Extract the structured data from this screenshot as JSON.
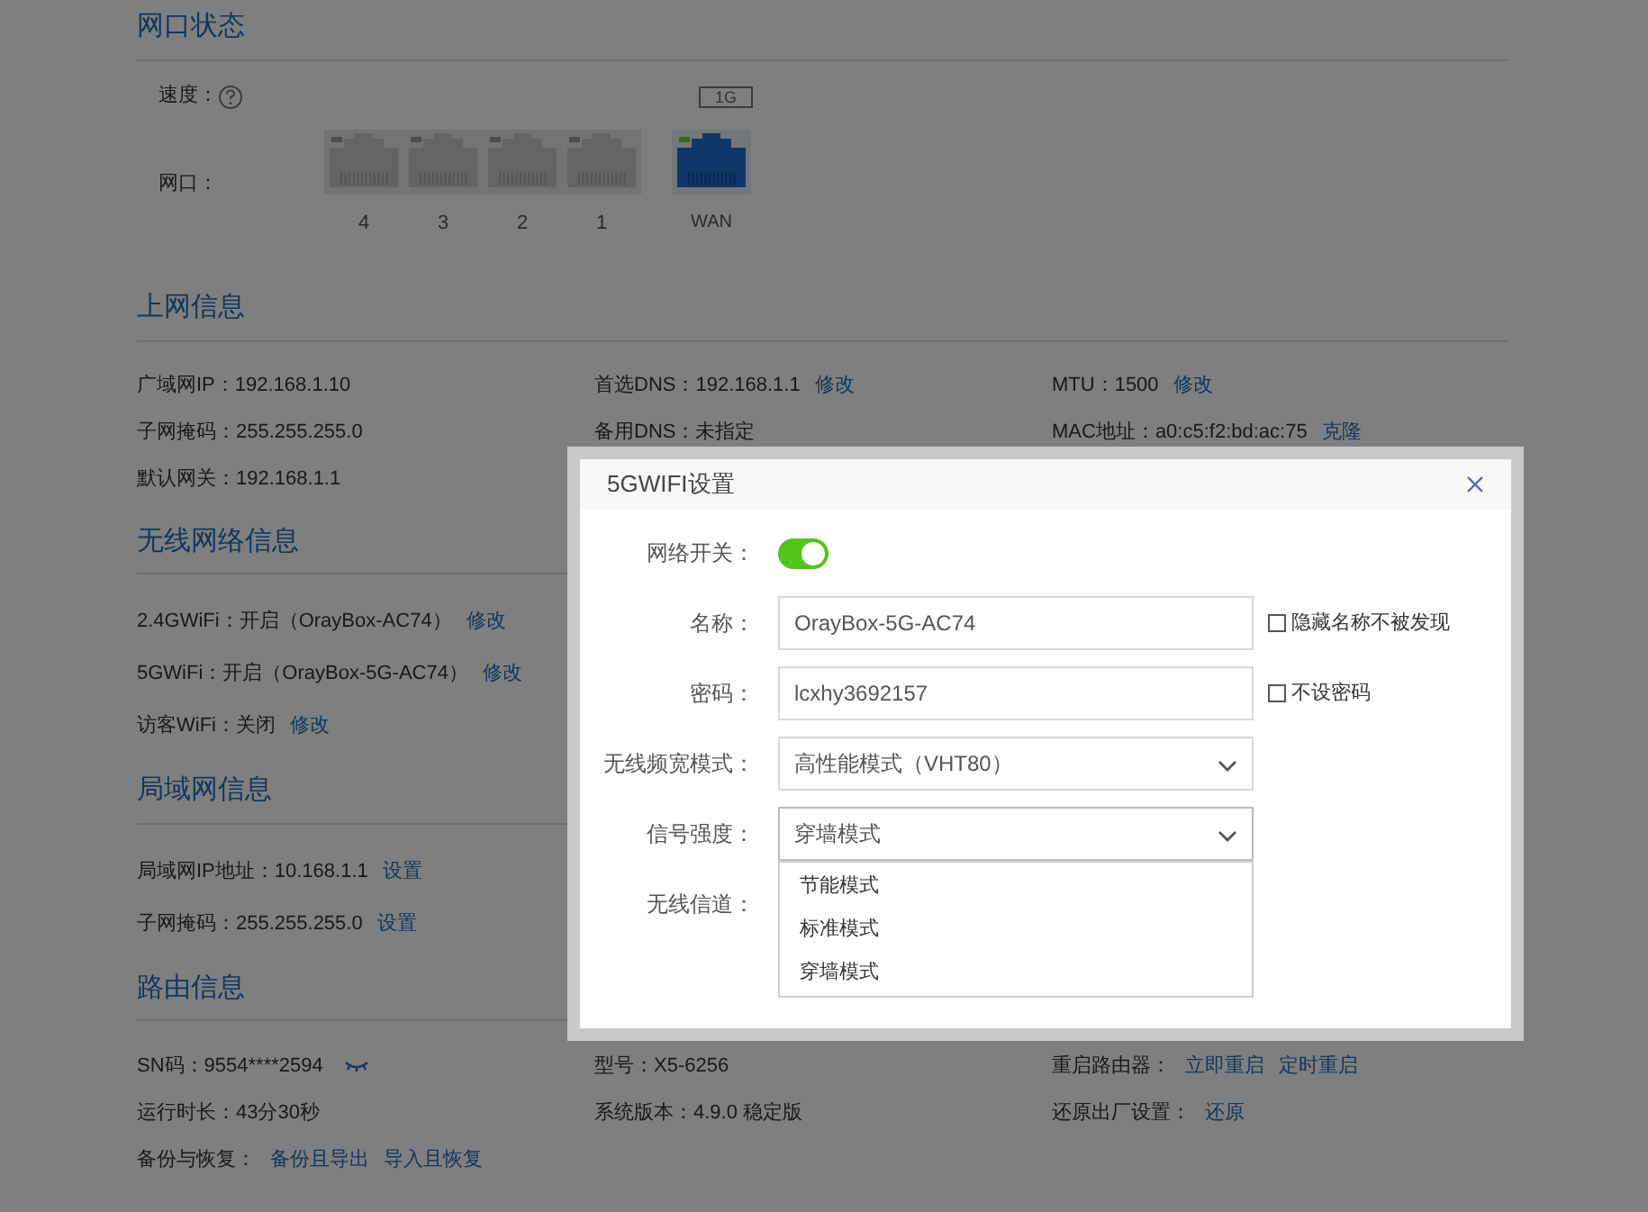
{
  "sections": [
    {
      "kind": "ports",
      "title": "网口状态",
      "speed_label": "速度：",
      "speed_badge": "1G",
      "port_label": "网口：",
      "ports": [
        {
          "label": "4",
          "connected": false
        },
        {
          "label": "3",
          "connected": false
        },
        {
          "label": "2",
          "connected": false
        },
        {
          "label": "1",
          "connected": false
        },
        {
          "label": "WAN",
          "connected": true
        }
      ]
    },
    {
      "kind": "grid",
      "title": "上网信息",
      "rows": [
        [
          {
            "text": "广域网IP：192.168.1.10"
          },
          {
            "text": "首选DNS：192.168.1.1",
            "links": [
              "修改"
            ]
          },
          {
            "text": "MTU：1500",
            "links": [
              "修改"
            ]
          }
        ],
        [
          {
            "text": "子网掩码：255.255.255.0"
          },
          {
            "text": "备用DNS：未指定"
          },
          {
            "text": "MAC地址：a0:c5:f2:bd:ac:75",
            "links": [
              "克隆"
            ]
          }
        ],
        [
          {
            "text": "默认网关：192.168.1.1"
          }
        ]
      ]
    },
    {
      "kind": "list",
      "title": "无线网络信息",
      "rows": [
        [
          {
            "text": "2.4GWiFi：开启（OrayBox-AC74）",
            "links": [
              "修改"
            ]
          }
        ],
        [
          {
            "text": "5GWiFi：开启（OrayBox-5G-AC74）",
            "links": [
              "修改"
            ]
          }
        ],
        [
          {
            "text": "访客WiFi：关闭",
            "links": [
              "修改"
            ]
          }
        ]
      ]
    },
    {
      "kind": "list",
      "title": "局域网信息",
      "rows": [
        [
          {
            "text": "局域网IP地址：10.168.1.1",
            "links": [
              "设置"
            ]
          }
        ],
        [
          {
            "text": "子网掩码：255.255.255.0",
            "links": [
              "设置"
            ]
          }
        ]
      ]
    },
    {
      "kind": "grid",
      "title": "路由信息",
      "rows": [
        [
          {
            "text": "SN码：9554****2594",
            "reveal_toggle": true
          },
          {
            "text": "型号：X5-6256"
          },
          {
            "text": "重启路由器：",
            "links": [
              "立即重启",
              "定时重启"
            ]
          }
        ],
        [
          {
            "text": "运行时长：43分30秒"
          },
          {
            "text": "系统版本：4.9.0 稳定版"
          },
          {
            "text": "还原出厂设置：",
            "links": [
              "还原"
            ]
          }
        ],
        [
          {
            "text": "备份与恢复：",
            "links": [
              "备份且导出",
              "导入且恢复"
            ]
          }
        ]
      ]
    }
  ],
  "dialog": {
    "title": "5GWIFI设置",
    "fields": [
      {
        "kind": "switch",
        "label": "网络开关：",
        "on": true
      },
      {
        "kind": "text",
        "label": "名称：",
        "value": "OrayBox-5G-AC74",
        "checkbox": {
          "label": "隐藏名称不被发现",
          "checked": false
        }
      },
      {
        "kind": "text",
        "label": "密码：",
        "value": "lcxhy3692157",
        "checkbox": {
          "label": "不设密码",
          "checked": false
        }
      },
      {
        "kind": "select",
        "label": "无线频宽模式：",
        "value": "高性能模式（VHT80）"
      },
      {
        "kind": "select",
        "label": "信号强度：",
        "value": "穿墙模式",
        "expanded": true,
        "options": [
          "节能模式",
          "标准模式",
          "穿墙模式"
        ]
      },
      {
        "kind": "covered",
        "label": "无线信道："
      }
    ]
  }
}
